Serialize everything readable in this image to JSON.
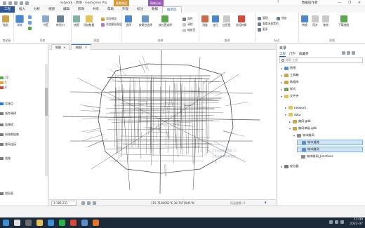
{
  "title_bar": {
    "title": "network - 地图 - GeoScene Pro",
    "context_tab_a": "要素图层",
    "context_tab_b": "网络分析",
    "help": "?",
    "user": "数据操作者",
    "window_controls": "— ❐ ✕"
  },
  "ribbon_tabs": [
    "工程",
    "插入",
    "分析",
    "视图",
    "编辑",
    "影像",
    "共享",
    "帮助",
    "外观",
    "标注",
    "数据",
    "服务区"
  ],
  "ribbon": {
    "groups": {
      "clipboard": "剪贴板",
      "navigate": "导航",
      "layer": "图层",
      "selection": "选择",
      "query": "查询",
      "labeling": "标注",
      "offline": "离线"
    },
    "buttons": {
      "paste": "粘贴",
      "explore": "浏览",
      "bookmarks": "书签",
      "goto": "转到XY",
      "basemap": "底图",
      "add_data": "添加数据",
      "add_preset": "添加预设",
      "add_graphics_layer": "添加图形图层",
      "select": "选择",
      "select_by_attributes": "按属性选择",
      "select_by_location": "按位置选择",
      "attributes": "属性",
      "clear": "清除",
      "zoom_to": "缩放至",
      "measure": "测量",
      "locate": "定位",
      "infographics": "信息图",
      "coordinate_conversion": "坐标转换",
      "manage": "管理",
      "lock": "锁定",
      "view_unplaced": "查看未放置的",
      "more": "更多",
      "convert": "转换",
      "sync": "同步",
      "download_map": "下载地图",
      "remove": "移除"
    }
  },
  "contents_pane": {
    "rows": [
      {
        "label": "10",
        "color": "#5aa84b"
      },
      {
        "label": "5",
        "color": "#e2a23a"
      },
      {
        "label": "0",
        "color": "#d24b3a"
      },
      {
        "label": "设施点",
        "color": "#2b78d0"
      },
      {
        "label": "线性障碍",
        "color": "#7a7a7a"
      },
      {
        "label": "面障碍",
        "color": "#7a7a7a"
      },
      {
        "label": "网络数据集",
        "color": "#7a7a7a"
      },
      {
        "label": "路网连接",
        "color": "#7a7a7a"
      },
      {
        "label": "道路",
        "color": "#7a7a7a"
      },
      {
        "label": "地形图",
        "color": "#7a7a7a"
      }
    ]
  },
  "map_view": {
    "tabs": [
      {
        "label": "地图",
        "active": false
      },
      {
        "label": "地图1",
        "active": true
      }
    ],
    "ghost_text": [
      "正在加载图层数据 1/1",
      "正在绘制 网络数据集",
      "完成"
    ],
    "scale": "1:189,231",
    "coordinates": "115.7100052°E 38.7471945°N",
    "selected_features": "所选要素: 0",
    "pause": "⏸"
  },
  "catalog_pane": {
    "title": "目录",
    "tabs": [
      {
        "label": "工程",
        "active": true
      },
      {
        "label": "门户",
        "active": false
      },
      {
        "label": "收藏夹",
        "active": false
      }
    ],
    "search_placeholder": "搜索 工程",
    "tree": [
      {
        "label": "地图",
        "level": 0,
        "arrow": "▸",
        "icon": "#5a8fc9",
        "highlight": false
      },
      {
        "label": "工具箱",
        "level": 0,
        "arrow": "▸",
        "icon": "#c9a44a",
        "highlight": false
      },
      {
        "label": "数据库",
        "level": 0,
        "arrow": "▸",
        "icon": "#c9a44a",
        "highlight": false
      },
      {
        "label": "样式",
        "level": 0,
        "arrow": "▸",
        "icon": "#7a9a5a",
        "highlight": false
      },
      {
        "label": "文件夹",
        "level": 0,
        "arrow": "▾",
        "icon": "#e3c45a",
        "highlight": false
      },
      {
        "label": "network",
        "level": 1,
        "arrow": "▸",
        "icon": "#e3c45a",
        "highlight": false
      },
      {
        "label": "data",
        "level": 1,
        "arrow": "▾",
        "icon": "#e3c45a",
        "highlight": false
      },
      {
        "label": "路网.gdb",
        "level": 2,
        "arrow": "▸",
        "icon": "#c9a44a",
        "highlight": false
      },
      {
        "label": "路网单级.gdb",
        "level": 2,
        "arrow": "▾",
        "icon": "#c9a44a",
        "highlight": false
      },
      {
        "label": "城市路网",
        "level": 3,
        "arrow": "▾",
        "icon": "#8a8a8a",
        "highlight": false
      },
      {
        "label": "城市道路",
        "level": 4,
        "arrow": "",
        "icon": "#5a8fc9",
        "highlight": true
      },
      {
        "label": "城市路网",
        "level": 4,
        "arrow": "",
        "icon": "#5a8fc9",
        "highlight": true
      },
      {
        "label": "城市路网_Junctions",
        "level": 4,
        "arrow": "",
        "icon": "#8a8a8a",
        "highlight": false
      },
      {
        "label": "定位器",
        "level": 0,
        "arrow": "▸",
        "icon": "#7a7a7a",
        "highlight": false
      }
    ]
  },
  "taskbar": {
    "time": "11:00",
    "date": "2022-07"
  }
}
